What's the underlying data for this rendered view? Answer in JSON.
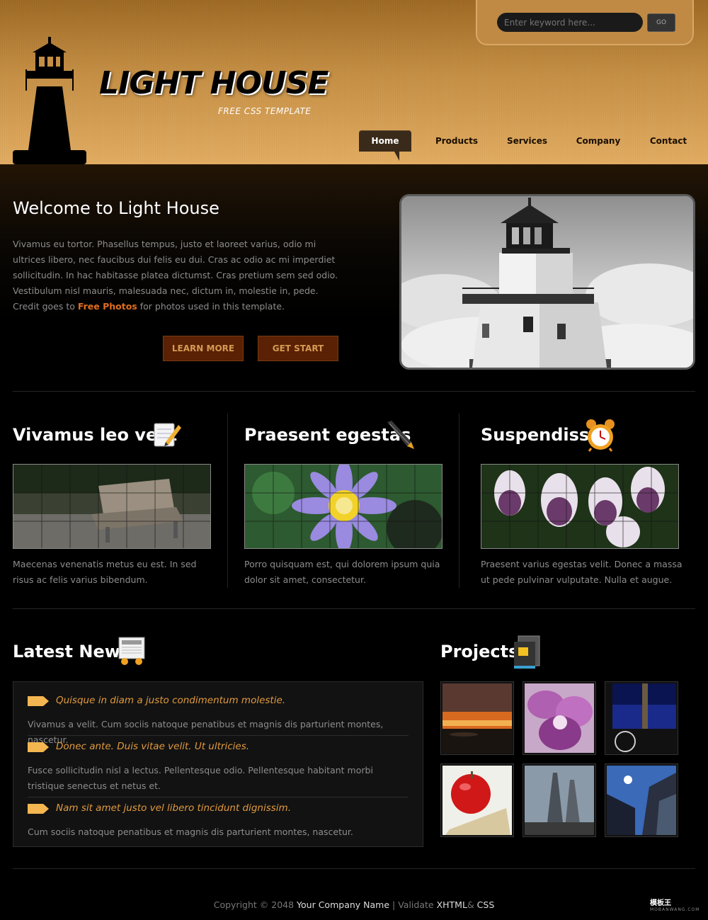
{
  "header": {
    "logo_title": "LIGHT HOUSE",
    "logo_subtitle": "FREE CSS TEMPLATE",
    "search_placeholder": "Enter keyword here...",
    "search_button": "GO"
  },
  "nav": {
    "items": [
      {
        "label": "Home",
        "active": true
      },
      {
        "label": "Products",
        "active": false
      },
      {
        "label": "Services",
        "active": false
      },
      {
        "label": "Company",
        "active": false
      },
      {
        "label": "Contact",
        "active": false
      }
    ]
  },
  "banner": {
    "title": "Welcome to Light House",
    "text_before_link": "Vivamus eu tortor. Phasellus tempus, justo et laoreet varius, odio mi ultrices libero, nec faucibus dui felis eu dui. Cras ac odio ac mi imperdiet sollicitudin. In hac habitasse platea dictumst. Cras pretium sem sed odio. Vestibulum nisl mauris, malesuada nec, dictum in, molestie in, pede. Credit goes to",
    "link_text": "Free Photos",
    "text_after_link": "for photos used in this template.",
    "learn_more": "LEARN MORE",
    "get_start": "GET START"
  },
  "columns": [
    {
      "title": "Vivamus leo velit",
      "icon": "notepad-pencil-icon",
      "text": "Maecenas venenatis metus eu est. In sed risus ac felis varius bibendum."
    },
    {
      "title": "Praesent egestas",
      "icon": "fountain-pen-icon",
      "text": "Porro quisquam est, qui dolorem ipsum quia dolor sit amet, consectetur."
    },
    {
      "title": "Suspendisse",
      "icon": "alarm-clock-icon",
      "text": "Praesent varius egestas velit. Donec a massa ut pede pulvinar vulputate. Nulla et augue."
    }
  ],
  "news": {
    "title": "Latest News",
    "items": [
      {
        "headline": "Quisque in diam a justo condimentum molestie.",
        "body": "Vivamus a velit. Cum sociis natoque penatibus et magnis dis parturient montes, nascetur."
      },
      {
        "headline": "Donec ante. Duis vitae velit. Ut ultricies.",
        "body": "Fusce sollicitudin nisl a lectus. Pellentesque odio. Pellentesque habitant morbi tristique senectus et netus et."
      },
      {
        "headline": "Nam sit amet justo vel libero tincidunt dignissim.",
        "body": "Cum sociis natoque penatibus et magnis dis parturient montes, nascetur."
      }
    ]
  },
  "projects": {
    "title": "Projects",
    "thumbnails": [
      "sunset",
      "orchid",
      "tower-window",
      "apple-notebook",
      "skyscrapers",
      "glass-buildings"
    ]
  },
  "footer": {
    "copyright": "Copyright © 2048",
    "company": "Your Company Name",
    "sep": "|",
    "validate": "Validate",
    "xhtml": "XHTML",
    "amp": "&",
    "css": "CSS",
    "badge_cn": "模板王",
    "badge_url": "MOBANWANG.COM"
  },
  "colors": {
    "accent_orange": "#e06d1c",
    "news_headline": "#e09a3e",
    "header_gradient_top": "#9e6a25",
    "header_gradient_bottom": "#e2ad62"
  }
}
